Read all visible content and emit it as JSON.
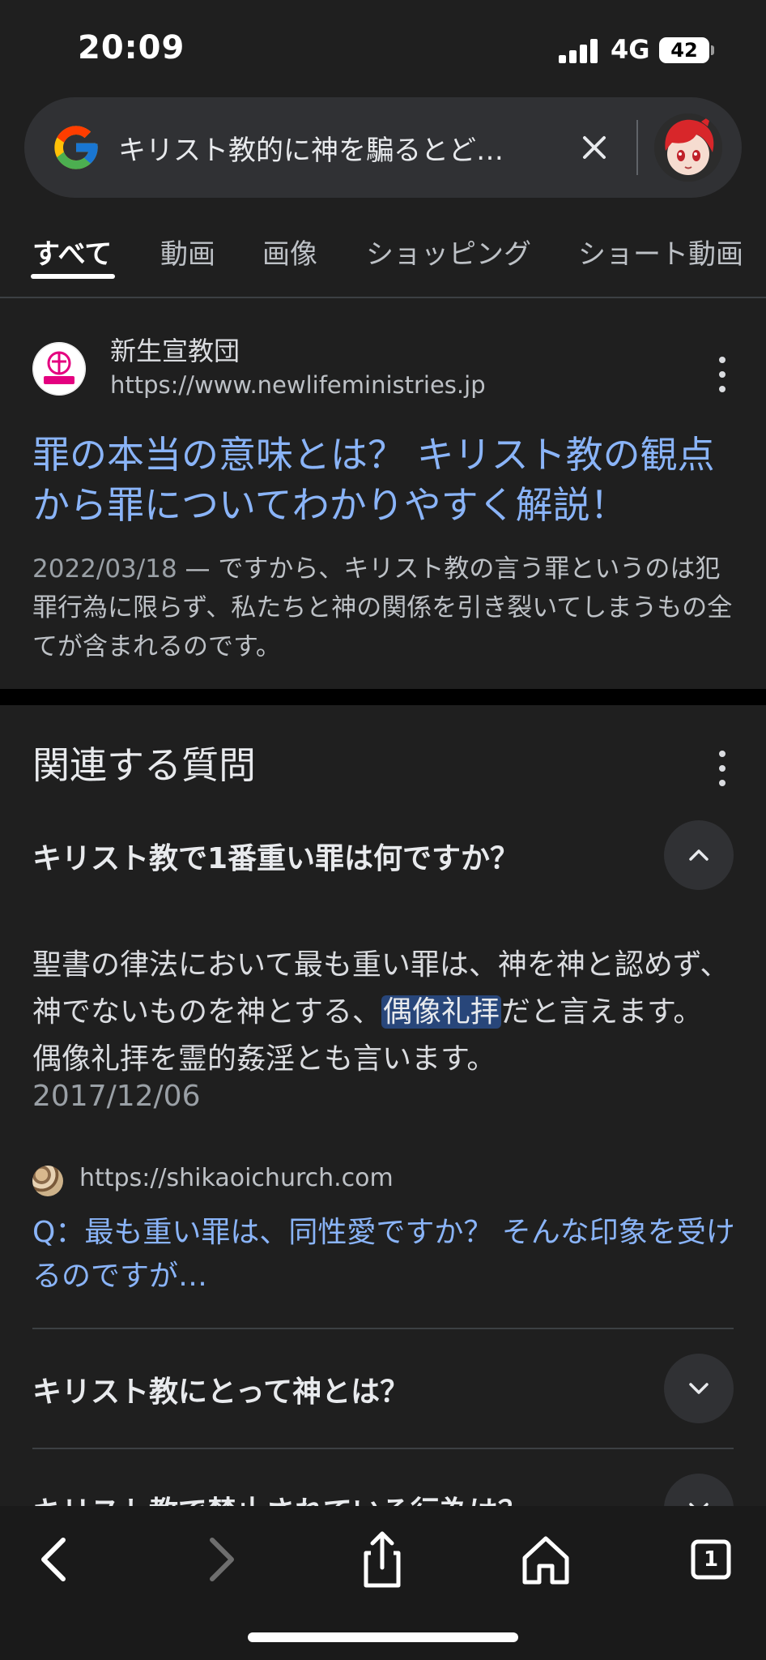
{
  "status_bar": {
    "time": "20:09",
    "network": "4G",
    "battery": "42"
  },
  "search": {
    "query": "キリスト教的に神を騙るとど…"
  },
  "tabs": [
    {
      "label": "すべて",
      "active": true
    },
    {
      "label": "動画"
    },
    {
      "label": "画像"
    },
    {
      "label": "ショッピング"
    },
    {
      "label": "ショート動画"
    }
  ],
  "result": {
    "site_name": "新生宣教団",
    "url": "https://www.newlifeministries.jp",
    "title": "罪の本当の意味とは？ キリスト教の観点から罪についてわかりやすく解説！",
    "date": "2022/03/18",
    "snippet": " — ですから、キリスト教の言う罪というのは犯罪行為に限らず、私たちと神の関係を引き裂いてしまうもの全てが含まれるのです。"
  },
  "related": {
    "title": "関連する質問",
    "questions": [
      {
        "text": "キリスト教で1番重い罪は何ですか？",
        "expanded": true,
        "answer_before": "聖書の律法において最も重い罪は、神を神と認めず、神でないものを神とする、",
        "answer_highlight": "偶像礼拝",
        "answer_after": "だと言えます。 偶像礼拝を霊的姦淫とも言います。",
        "answer_date": "2017/12/06",
        "source_url": "https://shikaoichurch.com",
        "source_title": "Q：最も重い罪は、同性愛ですか？ そんな印象を受けるのですが…"
      },
      {
        "text": "キリスト教にとって神とは？",
        "expanded": false
      },
      {
        "text": "キリスト教で禁止されている行為は？",
        "expanded": false
      }
    ]
  },
  "toolbar": {
    "tab_count": "1"
  },
  "colors": {
    "link": "#8ab4f8",
    "background": "#1f1f1f",
    "highlight": "#28467a"
  }
}
